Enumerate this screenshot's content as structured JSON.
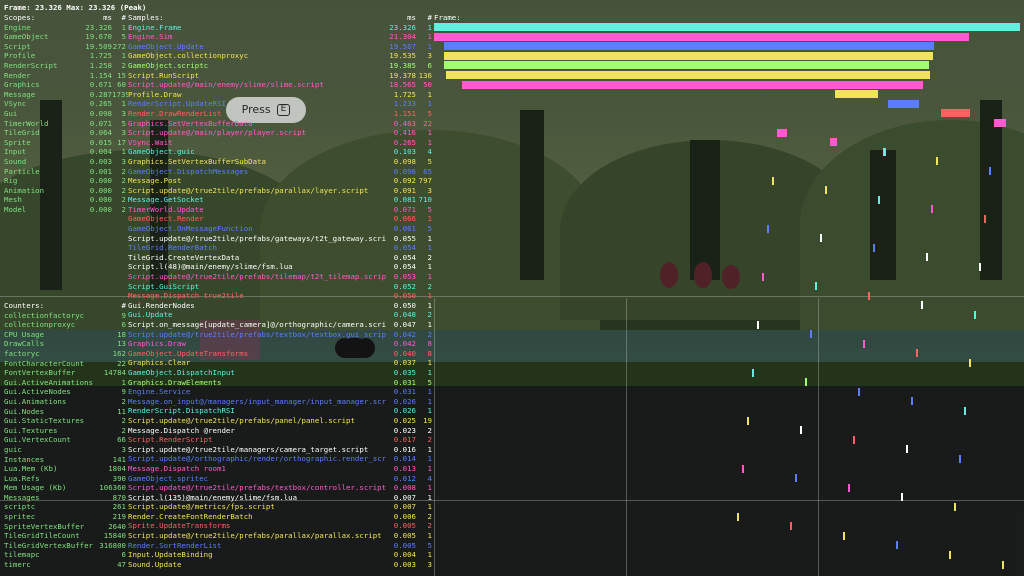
{
  "topline": "Frame: 23.326 Max: 23.326 (Peak)",
  "headers": {
    "scopes": "Scopes:",
    "scopes_ms": "ms",
    "scopes_count": "#",
    "samples": "Samples:",
    "samples_ms": "ms",
    "samples_count": "#",
    "frame": "Frame:",
    "counters": "Counters:",
    "counters_count": "#"
  },
  "prompt": {
    "label": "Press",
    "key": "E"
  },
  "scopes": [
    {
      "name": "Engine",
      "ms": "23.326",
      "count": "1",
      "color": "green"
    },
    {
      "name": "GameObject",
      "ms": "19.670",
      "count": "5",
      "color": "green"
    },
    {
      "name": "Script",
      "ms": "19.509",
      "count": "272",
      "color": "green"
    },
    {
      "name": "Profile",
      "ms": "1.725",
      "count": "1",
      "color": "green"
    },
    {
      "name": "RenderScript",
      "ms": "1.258",
      "count": "2",
      "color": "green"
    },
    {
      "name": "Render",
      "ms": "1.154",
      "count": "15",
      "color": "green"
    },
    {
      "name": "Graphics",
      "ms": "0.671",
      "count": "60",
      "color": "green"
    },
    {
      "name": "Message",
      "ms": "0.287",
      "count": "1739",
      "color": "green"
    },
    {
      "name": "VSync",
      "ms": "0.265",
      "count": "1",
      "color": "green"
    },
    {
      "name": "Gui",
      "ms": "0.098",
      "count": "3",
      "color": "green"
    },
    {
      "name": "TimerWorld",
      "ms": "0.071",
      "count": "5",
      "color": "green"
    },
    {
      "name": "TileGrid",
      "ms": "0.064",
      "count": "3",
      "color": "green"
    },
    {
      "name": "Sprite",
      "ms": "0.015",
      "count": "17",
      "color": "green"
    },
    {
      "name": "Input",
      "ms": "0.004",
      "count": "1",
      "color": "green"
    },
    {
      "name": "Sound",
      "ms": "0.003",
      "count": "3",
      "color": "green"
    },
    {
      "name": "Particle",
      "ms": "0.001",
      "count": "2",
      "color": "green"
    },
    {
      "name": "Rig",
      "ms": "0.000",
      "count": "2",
      "color": "green"
    },
    {
      "name": "Animation",
      "ms": "0.000",
      "count": "2",
      "color": "green"
    },
    {
      "name": "Mesh",
      "ms": "0.000",
      "count": "2",
      "color": "green"
    },
    {
      "name": "Model",
      "ms": "0.000",
      "count": "2",
      "color": "green"
    }
  ],
  "samples": [
    {
      "name": "Engine.Frame",
      "ms": "23.326",
      "count": "1",
      "color": "cyan"
    },
    {
      "name": "Engine.Sim",
      "ms": "21.304",
      "count": "1",
      "color": "pink"
    },
    {
      "name": "GameObject.Update",
      "ms": "19.567",
      "count": "1",
      "color": "blue"
    },
    {
      "name": "GameObject.collectionproxyc",
      "ms": "19.535",
      "count": "3",
      "color": "yellow"
    },
    {
      "name": "GameObject.scriptc",
      "ms": "19.385",
      "count": "6",
      "color": "lightgreen"
    },
    {
      "name": "Script.RunScript",
      "ms": "19.378",
      "count": "136",
      "color": "yellow"
    },
    {
      "name": "Script.update@/main/enemy/slime/slime.script",
      "ms": "18.565",
      "count": "50",
      "color": "pink"
    },
    {
      "name": "Profile.Draw",
      "ms": "1.725",
      "count": "1",
      "color": "yellow"
    },
    {
      "name": "RenderScript.UpdateRSI",
      "ms": "1.233",
      "count": "1",
      "color": "blue"
    },
    {
      "name": "Render.DrawRenderList",
      "ms": "1.151",
      "count": "5",
      "color": "red"
    },
    {
      "name": "Graphics.SetVertexBufferData",
      "ms": "0.463",
      "count": "22",
      "color": "pink"
    },
    {
      "name": "Script.update@/main/player/player.script",
      "ms": "0.416",
      "count": "1",
      "color": "pink"
    },
    {
      "name": "VSync.Wait",
      "ms": "0.265",
      "count": "1",
      "color": "pink"
    },
    {
      "name": "GameObject.guic",
      "ms": "0.103",
      "count": "4",
      "color": "cyan"
    },
    {
      "name": "Graphics.SetVertexBufferSubData",
      "ms": "0.098",
      "count": "5",
      "color": "yellow"
    },
    {
      "name": "GameObject.DispatchMessages",
      "ms": "0.096",
      "count": "65",
      "color": "blue"
    },
    {
      "name": "Message.Post",
      "ms": "0.092",
      "count": "797",
      "color": "yellow"
    },
    {
      "name": "Script.update@/true2tile/prefabs/parallax/layer.script",
      "ms": "0.091",
      "count": "3",
      "color": "yellow"
    },
    {
      "name": "Message.GetSocket",
      "ms": "0.081",
      "count": "710",
      "color": "cyan"
    },
    {
      "name": "TimerWorld.Update",
      "ms": "0.071",
      "count": "5",
      "color": "pink"
    },
    {
      "name": "GameObject.Render",
      "ms": "0.066",
      "count": "1",
      "color": "red"
    },
    {
      "name": "GameObject.OnMessageFunction",
      "ms": "0.061",
      "count": "5",
      "color": "blue"
    },
    {
      "name": "Script.update@/true2tile/prefabs/gateways/t2t_gateway.script",
      "ms": "0.055",
      "count": "1",
      "color": "white"
    },
    {
      "name": "TileGrid.RenderBatch",
      "ms": "0.054",
      "count": "1",
      "color": "blue"
    },
    {
      "name": "TileGrid.CreateVertexData",
      "ms": "0.054",
      "count": "2",
      "color": "white"
    },
    {
      "name": "Script.l(48)@main/enemy/slime/fsm.lua",
      "ms": "0.054",
      "count": "1",
      "color": "white"
    },
    {
      "name": "Script.update@/true2tile/prefabs/tilemap/t2t_tilemap.script",
      "ms": "0.053",
      "count": "1",
      "color": "pink"
    },
    {
      "name": "Script.GuiScript",
      "ms": "0.052",
      "count": "2",
      "color": "cyan"
    },
    {
      "name": "Message.Dispatch true2tile",
      "ms": "0.050",
      "count": "1",
      "color": "red"
    },
    {
      "name": "Gui.RenderNodes",
      "ms": "0.050",
      "count": "1",
      "color": "white"
    },
    {
      "name": "Gui.Update",
      "ms": "0.048",
      "count": "2",
      "color": "cyan"
    },
    {
      "name": "Script.on_message[update_camera]@/orthographic/camera.script",
      "ms": "0.047",
      "count": "1",
      "color": "white"
    },
    {
      "name": "Script.update@/true2tile/prefabs/textbox/textbox.gui_script",
      "ms": "0.042",
      "count": "2",
      "color": "blue"
    },
    {
      "name": "Graphics.Draw",
      "ms": "0.042",
      "count": "8",
      "color": "pink"
    },
    {
      "name": "GameObject.UpdateTransforms",
      "ms": "0.040",
      "count": "8",
      "color": "red"
    },
    {
      "name": "Graphics.Clear",
      "ms": "0.037",
      "count": "1",
      "color": "yellow"
    },
    {
      "name": "GameObject.DispatchInput",
      "ms": "0.035",
      "count": "1",
      "color": "cyan"
    },
    {
      "name": "Graphics.DrawElements",
      "ms": "0.031",
      "count": "5",
      "color": "lightgreen"
    },
    {
      "name": "Engine.Service",
      "ms": "0.031",
      "count": "1",
      "color": "blue"
    },
    {
      "name": "Message.on_input@/managers/input_manager/input_manager.script",
      "ms": "0.026",
      "count": "1",
      "color": "blue"
    },
    {
      "name": "RenderScript.DispatchRSI",
      "ms": "0.026",
      "count": "1",
      "color": "cyan"
    },
    {
      "name": "Script.update@/true2tile/prefabs/panel/panel.script",
      "ms": "0.025",
      "count": "19",
      "color": "yellow"
    },
    {
      "name": "Message.Dispatch @render",
      "ms": "0.023",
      "count": "2",
      "color": "white"
    },
    {
      "name": "Script.RenderScript",
      "ms": "0.017",
      "count": "2",
      "color": "red"
    },
    {
      "name": "Script.update@/true2tile/managers/camera_target.script",
      "ms": "0.016",
      "count": "1",
      "color": "white"
    },
    {
      "name": "Script.update@/orthographic/render/orthographic.render_script",
      "ms": "0.014",
      "count": "1",
      "color": "blue"
    },
    {
      "name": "Message.Dispatch room1",
      "ms": "0.013",
      "count": "1",
      "color": "pink"
    },
    {
      "name": "GameObject.spritec",
      "ms": "0.012",
      "count": "4",
      "color": "blue"
    },
    {
      "name": "Script.update@/true2tile/prefabs/textbox/controller.script",
      "ms": "0.008",
      "count": "1",
      "color": "pink"
    },
    {
      "name": "Script.l(135)@main/enemy/slime/fsm.lua",
      "ms": "0.007",
      "count": "1",
      "color": "white"
    },
    {
      "name": "Script.update@/metrics/fps.script",
      "ms": "0.007",
      "count": "1",
      "color": "yellow"
    },
    {
      "name": "Render.CreateFontRenderBatch",
      "ms": "0.006",
      "count": "2",
      "color": "yellow"
    },
    {
      "name": "Sprite.UpdateTransforms",
      "ms": "0.005",
      "count": "2",
      "color": "red"
    },
    {
      "name": "Script.update@/true2tile/prefabs/parallax/parallax.script",
      "ms": "0.005",
      "count": "1",
      "color": "yellow"
    },
    {
      "name": "Render.SortRenderList",
      "ms": "0.005",
      "count": "5",
      "color": "blue"
    },
    {
      "name": "Input.UpdateBinding",
      "ms": "0.004",
      "count": "1",
      "color": "yellow"
    },
    {
      "name": "Sound.Update",
      "ms": "0.003",
      "count": "3",
      "color": "yellow"
    }
  ],
  "counters": [
    {
      "name": "collectionfactoryc",
      "value": "9"
    },
    {
      "name": "collectionproxyc",
      "value": "6"
    },
    {
      "name": "CPU Usage",
      "value": "18"
    },
    {
      "name": "DrawCalls",
      "value": "13"
    },
    {
      "name": "factoryc",
      "value": "162"
    },
    {
      "name": "FontCharacterCount",
      "value": "22"
    },
    {
      "name": "FontVertexBuffer",
      "value": "14784"
    },
    {
      "name": "Gui.ActiveAnimations",
      "value": "1"
    },
    {
      "name": "Gui.ActiveNodes",
      "value": "9"
    },
    {
      "name": "Gui.Animations",
      "value": "2"
    },
    {
      "name": "Gui.Nodes",
      "value": "11"
    },
    {
      "name": "Gui.StaticTextures",
      "value": "2"
    },
    {
      "name": "Gui.Textures",
      "value": "2"
    },
    {
      "name": "Gui.VertexCount",
      "value": "66"
    },
    {
      "name": "guic",
      "value": "3"
    },
    {
      "name": "Instances",
      "value": "141"
    },
    {
      "name": "Lua.Mem (Kb)",
      "value": "1804"
    },
    {
      "name": "Lua.Refs",
      "value": "390"
    },
    {
      "name": "Mem Usage (Kb)",
      "value": "106360"
    },
    {
      "name": "Messages",
      "value": "870"
    },
    {
      "name": "scriptc",
      "value": "261"
    },
    {
      "name": "spritec",
      "value": "219"
    },
    {
      "name": "SpriteVertexBuffer",
      "value": "2640"
    },
    {
      "name": "TileGridTileCount",
      "value": "15840"
    },
    {
      "name": "TileGridVertexBuffer",
      "value": "316800"
    },
    {
      "name": "tilemapc",
      "value": "6"
    },
    {
      "name": "timerc",
      "value": "47"
    }
  ],
  "colors": {
    "green": "#7fe07f",
    "yellow": "#f2e35c",
    "pink": "#ff5ad0",
    "blue": "#5b7dff",
    "cyan": "#5ff0e0",
    "red": "#ff6060",
    "lightgreen": "#a0ff70",
    "white": "#ffffff"
  }
}
